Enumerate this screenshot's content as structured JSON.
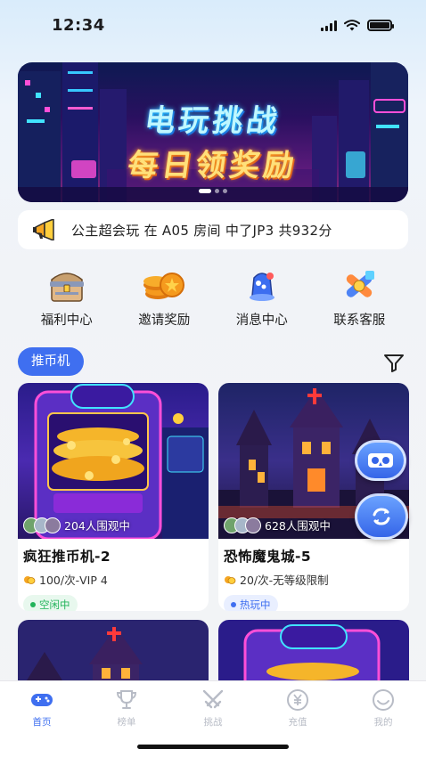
{
  "status_bar": {
    "time": "12:34"
  },
  "banner": {
    "title": "电玩挑战",
    "subtitle": "每日领奖励"
  },
  "notice": {
    "text": "公主超会玩 在 A05 房间 中了JP3 共932分"
  },
  "quick_menu": [
    {
      "label": "福利中心",
      "icon": "treasure-chest-icon"
    },
    {
      "label": "邀请奖励",
      "icon": "coins-icon"
    },
    {
      "label": "消息中心",
      "icon": "message-bell-icon"
    },
    {
      "label": "联系客服",
      "icon": "customer-service-icon"
    }
  ],
  "category": {
    "label": "推币机"
  },
  "cards": [
    {
      "name": "疯狂推币机-2",
      "viewers": "204人围观中",
      "price": "100/次-VIP 4",
      "status": "空闲中",
      "status_color": "#22b35a",
      "status_bg": "#e8f8ee"
    },
    {
      "name": "恐怖魔鬼城-5",
      "viewers": "628人围观中",
      "price": "20/次-无等级限制",
      "status": "热玩中",
      "status_color": "#3f6ff0",
      "status_bg": "#e9efff"
    }
  ],
  "bottom_nav": [
    {
      "label": "首页",
      "icon": "gamepad-icon",
      "active": true
    },
    {
      "label": "榜单",
      "icon": "trophy-icon",
      "active": false
    },
    {
      "label": "挑战",
      "icon": "swords-icon",
      "active": false
    },
    {
      "label": "充值",
      "icon": "yuan-coin-icon",
      "active": false
    },
    {
      "label": "我的",
      "icon": "smile-icon",
      "active": false
    }
  ],
  "colors": {
    "accent": "#3f6ff0",
    "nav_inactive": "#b8bcc6"
  }
}
